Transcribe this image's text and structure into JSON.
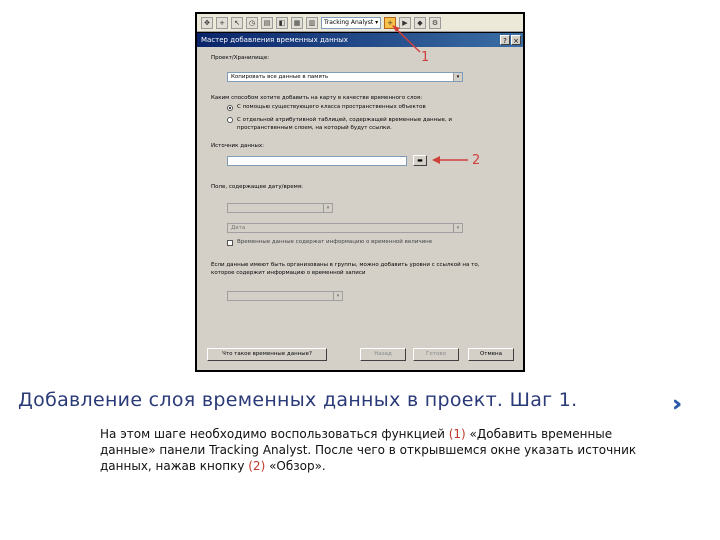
{
  "dialog": {
    "title": "Мастер добавления временных данных",
    "project_label": "Проект/Хранилище:",
    "project_value": "Копировать все данные в память",
    "add_as_label": "Каким способом хотите добавить на карту в качестве временного слоя:",
    "option1": "С помощью существующего класса пространственных объектов",
    "option2": "С отдельной атрибутивной таблицей, содержащей временные данные, и пространственным слоем, на который будут ссылки.",
    "source_label": "Источник данных:",
    "source_value": "",
    "time_field_label": "Поле, содержащее дату/время:",
    "format_value": "Дата",
    "checkbox_label": "Временные данные содержат информацию о временной величине",
    "bottom_text": "Если данные имеют быть организованы в группы, можно добавить уровни с ссылкой на то, которое содержит информацию о временной записи",
    "prev_label": "Назад",
    "next_label": "Готово",
    "cancel_label": "Отмена",
    "help_label": "Что такое временные данные?"
  },
  "callouts": {
    "one": "1",
    "two": "2"
  },
  "caption": "Добавление слоя временных данных в проект. Шаг 1.",
  "description": {
    "part1": "На этом шаге необходимо воспользоваться функцией ",
    "mark1": "(1)",
    "part2": " «Добавить временные данные» панели Tracking Analyst. После чего в открывшемся окне указать источник данных, нажав кнопку ",
    "mark2": "(2)",
    "part3": " «Обзор»."
  }
}
